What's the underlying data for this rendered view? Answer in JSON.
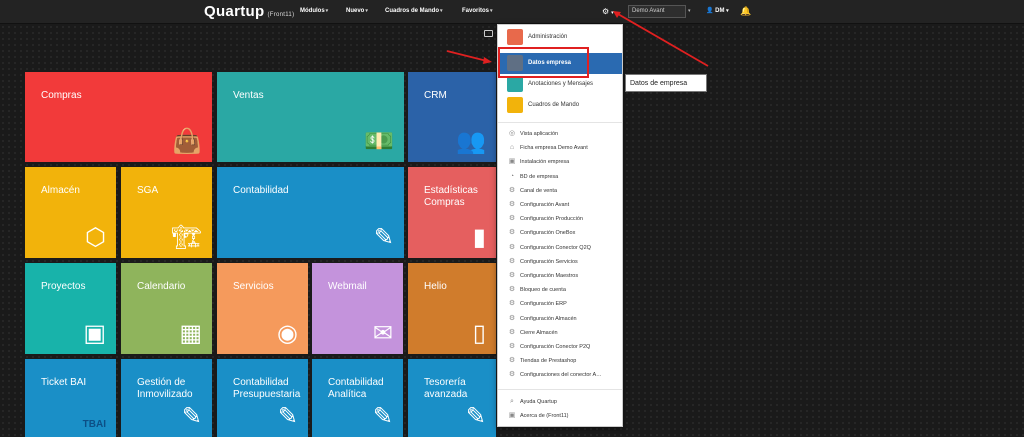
{
  "header": {
    "logo": "Quartup",
    "logo_sub": "(Front11)",
    "nav": [
      {
        "label": "Módulos"
      },
      {
        "label": "Nuevo"
      },
      {
        "label": "Cuadros de Mando"
      },
      {
        "label": "Favoritos"
      }
    ],
    "caret": "▾",
    "company_select": "Demo Avant",
    "user": "DM"
  },
  "tiles": [
    {
      "label": "Compras",
      "icon": "shopping-bag-icon",
      "glyph": "👜",
      "color": "#f23a3a"
    },
    {
      "label": "Ventas",
      "icon": "money-icon",
      "glyph": "💵",
      "color": "#2aa8a4"
    },
    {
      "label": "CRM",
      "icon": "users-icon",
      "glyph": "👥",
      "color": "#2b62a8"
    },
    {
      "label": "Almacén",
      "icon": "box-icon",
      "glyph": "⬡",
      "color": "#f2b30b"
    },
    {
      "label": "SGA",
      "icon": "forklift-icon",
      "glyph": "🏗",
      "color": "#f2b30b"
    },
    {
      "label": "Contabilidad",
      "icon": "edit-icon",
      "glyph": "✎",
      "color": "#1a8fc7"
    },
    {
      "label": "Estadísticas Compras",
      "icon": "bar-chart-icon",
      "glyph": "▮",
      "color": "#e55f5f"
    },
    {
      "label": "Proyectos",
      "icon": "presentation-icon",
      "glyph": "▣",
      "color": "#18b3aa"
    },
    {
      "label": "Calendario",
      "icon": "calendar-icon",
      "glyph": "▦",
      "color": "#8fb45c"
    },
    {
      "label": "Servicios",
      "icon": "headset-icon",
      "glyph": "◉",
      "color": "#f59a5c"
    },
    {
      "label": "Webmail",
      "icon": "envelope-icon",
      "glyph": "✉",
      "color": "#c493dc"
    },
    {
      "label": "Helio",
      "icon": "phone-icon",
      "glyph": "▯",
      "color": "#d07c2c"
    },
    {
      "label": "Ticket BAI",
      "icon": "tbai-icon",
      "glyph": "TBAI",
      "color": "#1a8fc7"
    },
    {
      "label": "Gestión de Inmovilizado",
      "icon": "edit-icon",
      "glyph": "✎",
      "color": "#1a8fc7"
    },
    {
      "label": "Contabilidad Presupuestaria",
      "icon": "edit-icon",
      "glyph": "✎",
      "color": "#1a8fc7"
    },
    {
      "label": "Contabilidad Analítica",
      "icon": "edit-icon",
      "glyph": "✎",
      "color": "#1a8fc7"
    },
    {
      "label": "Tesorería avanzada",
      "icon": "edit-icon",
      "glyph": "✎",
      "color": "#1a8fc7"
    }
  ],
  "dropdown": {
    "top_items": [
      {
        "label": "Administración",
        "icon_color": "#e8694b"
      },
      {
        "label": "Datos empresa",
        "icon_color": "#5f6f84"
      },
      {
        "label": "Anotaciones y Mensajes",
        "icon_color": "#2aa8a4"
      },
      {
        "label": "Cuadros de Mando",
        "icon_color": "#f2b30b"
      }
    ],
    "items": [
      {
        "label": "Vista aplicación",
        "glyph": "◎"
      },
      {
        "label": "Ficha empresa Demo Avant",
        "glyph": "⌂"
      },
      {
        "label": "Instalación empresa",
        "glyph": "▣"
      },
      {
        "label": "BD de empresa",
        "glyph": "◔"
      },
      {
        "label": "Canal de venta",
        "glyph": "⚙"
      },
      {
        "label": "Configuración Avant",
        "glyph": "⚙"
      },
      {
        "label": "Configuración Producción",
        "glyph": "⚙"
      },
      {
        "label": "Configuración OneBox",
        "glyph": "⚙"
      },
      {
        "label": "Configuración Conector Q2Q",
        "glyph": "⚙"
      },
      {
        "label": "Configuración Servicios",
        "glyph": "⚙"
      },
      {
        "label": "Configuración Maestros",
        "glyph": "⚙"
      },
      {
        "label": "Bloqueo de cuenta",
        "glyph": "⚙"
      },
      {
        "label": "Configuración ERP",
        "glyph": "⚙"
      },
      {
        "label": "Configuración Almacén",
        "glyph": "⚙"
      },
      {
        "label": "Cierre Almacén",
        "glyph": "⚙"
      },
      {
        "label": "Configuración Conector P2Q",
        "glyph": "⚙"
      },
      {
        "label": "Tiendas de Prestashop",
        "glyph": "⚙"
      },
      {
        "label": "Configuraciones del conector A…",
        "glyph": "⚙"
      }
    ],
    "footer": [
      {
        "label": "Ayuda Quartup",
        "glyph": "⌕"
      },
      {
        "label": "Acerca de (Front11)",
        "glyph": "▣"
      }
    ]
  },
  "tooltip": "Datos de empresa",
  "colors": {
    "annotation": "#e02020",
    "active": "#2a6ab1"
  }
}
